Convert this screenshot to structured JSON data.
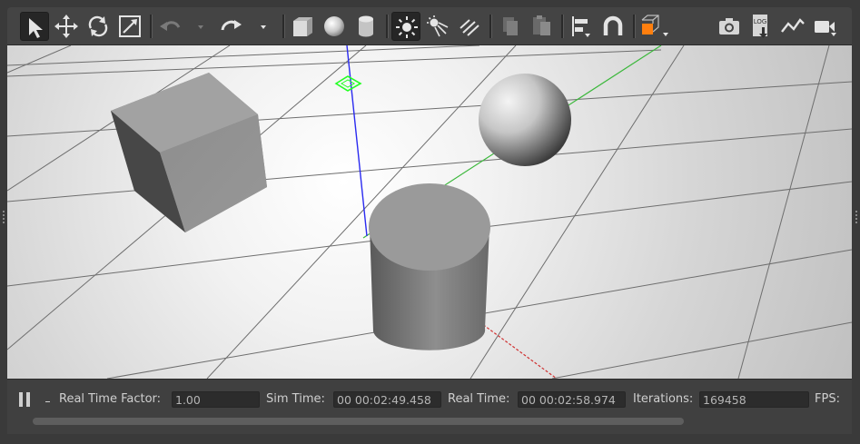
{
  "toolbar": {
    "tools": [
      {
        "name": "select-mode",
        "icon": "arrow-pointer-icon",
        "active": true
      },
      {
        "name": "translate-mode",
        "icon": "move-arrows-icon"
      },
      {
        "name": "rotate-mode",
        "icon": "rotate-icon"
      },
      {
        "name": "scale-mode",
        "icon": "scale-icon"
      },
      {
        "name": "undo",
        "icon": "undo-icon"
      },
      {
        "name": "undo-history",
        "icon": "caret-down-icon"
      },
      {
        "name": "redo",
        "icon": "redo-icon"
      },
      {
        "name": "redo-history",
        "icon": "caret-down-icon"
      },
      {
        "name": "insert-box",
        "icon": "box-icon"
      },
      {
        "name": "insert-sphere",
        "icon": "sphere-icon"
      },
      {
        "name": "insert-cylinder",
        "icon": "cylinder-icon"
      },
      {
        "name": "point-light",
        "icon": "sun-icon",
        "active": true
      },
      {
        "name": "spot-light",
        "icon": "spotlight-icon"
      },
      {
        "name": "directional-light",
        "icon": "directional-light-icon"
      },
      {
        "name": "copy",
        "icon": "copy-icon"
      },
      {
        "name": "paste",
        "icon": "paste-icon"
      },
      {
        "name": "align",
        "icon": "align-icon"
      },
      {
        "name": "snap",
        "icon": "magnet-icon"
      },
      {
        "name": "view-angle",
        "icon": "view-cube-icon"
      },
      {
        "name": "screenshot",
        "icon": "camera-icon"
      },
      {
        "name": "log-data",
        "icon": "log-icon",
        "text": "LOG"
      },
      {
        "name": "plot",
        "icon": "plot-icon"
      },
      {
        "name": "record-video",
        "icon": "video-camera-icon"
      }
    ],
    "accent_orange": "#ff7f0e"
  },
  "scene": {
    "objects": [
      "box",
      "sphere",
      "cylinder",
      "point-light"
    ],
    "axis_colors": {
      "x": "#d03030",
      "y": "#3cb83c",
      "z": "#2a2af0"
    },
    "light_marker_color": "#22ff22"
  },
  "status": {
    "real_time_factor_label": "Real Time Factor:",
    "real_time_factor_value": "1.00",
    "sim_time_label": "Sim Time:",
    "sim_time_value": "00 00:02:49.458",
    "real_time_label": "Real Time:",
    "real_time_value": "00 00:02:58.974",
    "iterations_label": "Iterations:",
    "iterations_value": "169458",
    "fps_label": "FPS:",
    "paused": false
  }
}
